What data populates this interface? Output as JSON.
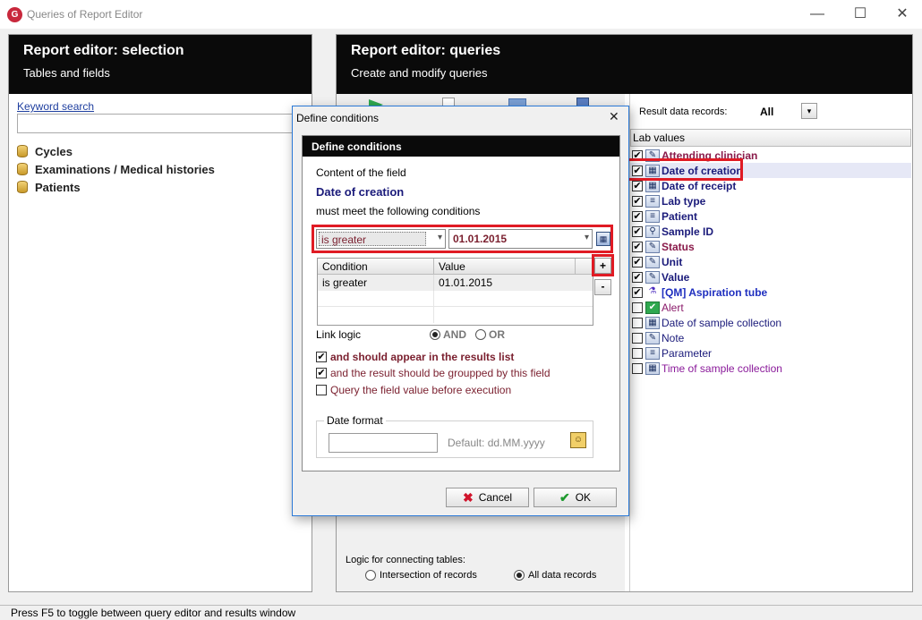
{
  "window": {
    "title": "Queries of Report Editor",
    "app_icon": "G"
  },
  "left_panel": {
    "title": "Report editor: selection",
    "subtitle": "Tables and fields",
    "keyword_label": "Keyword search",
    "keyword_value": "",
    "tree": [
      "Cycles",
      "Examinations / Medical histories",
      "Patients"
    ]
  },
  "right_panel": {
    "title": "Report editor: queries",
    "subtitle": "Create and modify queries",
    "result_label": "Result data records:",
    "result_value": "All",
    "fields_header": "Lab values",
    "fields": [
      {
        "label": "Attending clinician",
        "checked": true,
        "bold": true,
        "color": "#8a1a4a",
        "icon": "edit-icon"
      },
      {
        "label": "Date of creation",
        "checked": true,
        "bold": true,
        "color": "#1a1a7a",
        "icon": "calendar-icon",
        "selected": true
      },
      {
        "label": "Date of receipt",
        "checked": true,
        "bold": true,
        "color": "#1a1a7a",
        "icon": "calendar-icon"
      },
      {
        "label": "Lab type",
        "checked": true,
        "bold": true,
        "color": "#1a1a7a",
        "icon": "list-icon"
      },
      {
        "label": "Patient",
        "checked": true,
        "bold": true,
        "color": "#1a1a7a",
        "icon": "list-icon"
      },
      {
        "label": "Sample ID",
        "checked": true,
        "bold": true,
        "color": "#1a1a7a",
        "icon": "search-icon"
      },
      {
        "label": "Status",
        "checked": true,
        "bold": true,
        "color": "#8a1a4a",
        "icon": "edit-icon"
      },
      {
        "label": "Unit",
        "checked": true,
        "bold": true,
        "color": "#1a1a7a",
        "icon": "edit-icon"
      },
      {
        "label": "Value",
        "checked": true,
        "bold": true,
        "color": "#1a1a7a",
        "icon": "edit-icon"
      },
      {
        "label": "[QM] Aspiration tube",
        "checked": true,
        "bold": true,
        "color": "#1f2fbf",
        "icon": "flask-icon"
      },
      {
        "label": "Alert",
        "checked": false,
        "bold": false,
        "color": "#8a1a6a",
        "icon": "check-icon"
      },
      {
        "label": "Date of sample collection",
        "checked": false,
        "bold": false,
        "color": "#1a1a7a",
        "icon": "calendar-icon"
      },
      {
        "label": "Note",
        "checked": false,
        "bold": false,
        "color": "#1a1a7a",
        "icon": "edit-icon"
      },
      {
        "label": "Parameter",
        "checked": false,
        "bold": false,
        "color": "#1a1a7a",
        "icon": "list-icon"
      },
      {
        "label": "Time of sample collection",
        "checked": false,
        "bold": false,
        "color": "#8a1a9a",
        "icon": "calendar-icon"
      }
    ],
    "logic_label": "Logic for connecting tables:",
    "logic_opt1": "Intersection of records",
    "logic_opt2": "All data records",
    "logic_selected": "All data records"
  },
  "dialog": {
    "title": "Define conditions",
    "inner_title": "Define conditions",
    "content_label": "Content of the field",
    "field_name": "Date of creation",
    "must_meet": "must meet the following conditions",
    "operator": "is greater",
    "value": "01.01.2015",
    "grid_headers": [
      "Condition",
      "Value"
    ],
    "grid_rows": [
      [
        "is greater",
        "01.01.2015"
      ]
    ],
    "add_label": "+",
    "remove_label": "-",
    "link_logic_label": "Link logic",
    "and_label": "AND",
    "or_label": "OR",
    "opt_results": "and should appear in the results list",
    "opt_grouped": "and the result should be groupped by this field",
    "opt_query": "Query the field value before execution",
    "date_format_label": "Date format",
    "date_format_value": "",
    "date_default": "Default: dd.MM.yyyy",
    "cancel_label": "Cancel",
    "ok_label": "OK"
  },
  "status": {
    "text": "Press F5 to toggle between query editor and results window"
  },
  "colors": {
    "accent_red": "#e01b24",
    "header_black": "#0a0a0a",
    "dialog_border": "#2b79d7"
  }
}
